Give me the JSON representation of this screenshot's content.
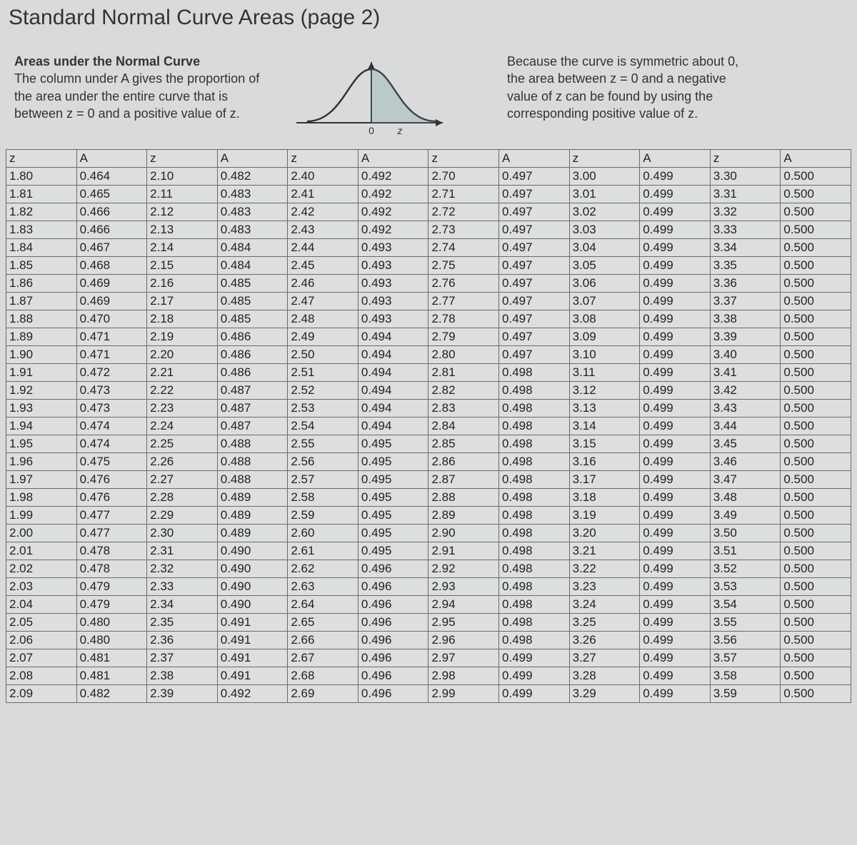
{
  "title": "Standard Normal Curve Areas (page 2)",
  "intro_left_title": "Areas under the Normal Curve",
  "intro_left_body": "The column under A gives the proportion of the area under the entire curve that is between z = 0 and a positive value of z.",
  "intro_right": "Because the curve is symmetric about 0, the area between z = 0 and a negative value of z can be found by using the corresponding positive value of z.",
  "curve_labels": {
    "origin": "0",
    "axis": "z"
  },
  "header": [
    "z",
    "A",
    "z",
    "A",
    "z",
    "A",
    "z",
    "A",
    "z",
    "A",
    "z",
    "A"
  ],
  "rows": [
    [
      "1.80",
      "0.464",
      "2.10",
      "0.482",
      "2.40",
      "0.492",
      "2.70",
      "0.497",
      "3.00",
      "0.499",
      "3.30",
      "0.500"
    ],
    [
      "1.81",
      "0.465",
      "2.11",
      "0.483",
      "2.41",
      "0.492",
      "2.71",
      "0.497",
      "3.01",
      "0.499",
      "3.31",
      "0.500"
    ],
    [
      "1.82",
      "0.466",
      "2.12",
      "0.483",
      "2.42",
      "0.492",
      "2.72",
      "0.497",
      "3.02",
      "0.499",
      "3.32",
      "0.500"
    ],
    [
      "1.83",
      "0.466",
      "2.13",
      "0.483",
      "2.43",
      "0.492",
      "2.73",
      "0.497",
      "3.03",
      "0.499",
      "3.33",
      "0.500"
    ],
    [
      "1.84",
      "0.467",
      "2.14",
      "0.484",
      "2.44",
      "0.493",
      "2.74",
      "0.497",
      "3.04",
      "0.499",
      "3.34",
      "0.500"
    ],
    [
      "1.85",
      "0.468",
      "2.15",
      "0.484",
      "2.45",
      "0.493",
      "2.75",
      "0.497",
      "3.05",
      "0.499",
      "3.35",
      "0.500"
    ],
    [
      "1.86",
      "0.469",
      "2.16",
      "0.485",
      "2.46",
      "0.493",
      "2.76",
      "0.497",
      "3.06",
      "0.499",
      "3.36",
      "0.500"
    ],
    [
      "1.87",
      "0.469",
      "2.17",
      "0.485",
      "2.47",
      "0.493",
      "2.77",
      "0.497",
      "3.07",
      "0.499",
      "3.37",
      "0.500"
    ],
    [
      "1.88",
      "0.470",
      "2.18",
      "0.485",
      "2.48",
      "0.493",
      "2.78",
      "0.497",
      "3.08",
      "0.499",
      "3.38",
      "0.500"
    ],
    [
      "1.89",
      "0.471",
      "2.19",
      "0.486",
      "2.49",
      "0.494",
      "2.79",
      "0.497",
      "3.09",
      "0.499",
      "3.39",
      "0.500"
    ],
    [
      "1.90",
      "0.471",
      "2.20",
      "0.486",
      "2.50",
      "0.494",
      "2.80",
      "0.497",
      "3.10",
      "0.499",
      "3.40",
      "0.500"
    ],
    [
      "1.91",
      "0.472",
      "2.21",
      "0.486",
      "2.51",
      "0.494",
      "2.81",
      "0.498",
      "3.11",
      "0.499",
      "3.41",
      "0.500"
    ],
    [
      "1.92",
      "0.473",
      "2.22",
      "0.487",
      "2.52",
      "0.494",
      "2.82",
      "0.498",
      "3.12",
      "0.499",
      "3.42",
      "0.500"
    ],
    [
      "1.93",
      "0.473",
      "2.23",
      "0.487",
      "2.53",
      "0.494",
      "2.83",
      "0.498",
      "3.13",
      "0.499",
      "3.43",
      "0.500"
    ],
    [
      "1.94",
      "0.474",
      "2.24",
      "0.487",
      "2.54",
      "0.494",
      "2.84",
      "0.498",
      "3.14",
      "0.499",
      "3.44",
      "0.500"
    ],
    [
      "1.95",
      "0.474",
      "2.25",
      "0.488",
      "2.55",
      "0.495",
      "2.85",
      "0.498",
      "3.15",
      "0.499",
      "3.45",
      "0.500"
    ],
    [
      "1.96",
      "0.475",
      "2.26",
      "0.488",
      "2.56",
      "0.495",
      "2.86",
      "0.498",
      "3.16",
      "0.499",
      "3.46",
      "0.500"
    ],
    [
      "1.97",
      "0.476",
      "2.27",
      "0.488",
      "2.57",
      "0.495",
      "2.87",
      "0.498",
      "3.17",
      "0.499",
      "3.47",
      "0.500"
    ],
    [
      "1.98",
      "0.476",
      "2.28",
      "0.489",
      "2.58",
      "0.495",
      "2.88",
      "0.498",
      "3.18",
      "0.499",
      "3.48",
      "0.500"
    ],
    [
      "1.99",
      "0.477",
      "2.29",
      "0.489",
      "2.59",
      "0.495",
      "2.89",
      "0.498",
      "3.19",
      "0.499",
      "3.49",
      "0.500"
    ],
    [
      "2.00",
      "0.477",
      "2.30",
      "0.489",
      "2.60",
      "0.495",
      "2.90",
      "0.498",
      "3.20",
      "0.499",
      "3.50",
      "0.500"
    ],
    [
      "2.01",
      "0.478",
      "2.31",
      "0.490",
      "2.61",
      "0.495",
      "2.91",
      "0.498",
      "3.21",
      "0.499",
      "3.51",
      "0.500"
    ],
    [
      "2.02",
      "0.478",
      "2.32",
      "0.490",
      "2.62",
      "0.496",
      "2.92",
      "0.498",
      "3.22",
      "0.499",
      "3.52",
      "0.500"
    ],
    [
      "2.03",
      "0.479",
      "2.33",
      "0.490",
      "2.63",
      "0.496",
      "2.93",
      "0.498",
      "3.23",
      "0.499",
      "3.53",
      "0.500"
    ],
    [
      "2.04",
      "0.479",
      "2.34",
      "0.490",
      "2.64",
      "0.496",
      "2.94",
      "0.498",
      "3.24",
      "0.499",
      "3.54",
      "0.500"
    ],
    [
      "2.05",
      "0.480",
      "2.35",
      "0.491",
      "2.65",
      "0.496",
      "2.95",
      "0.498",
      "3.25",
      "0.499",
      "3.55",
      "0.500"
    ],
    [
      "2.06",
      "0.480",
      "2.36",
      "0.491",
      "2.66",
      "0.496",
      "2.96",
      "0.498",
      "3.26",
      "0.499",
      "3.56",
      "0.500"
    ],
    [
      "2.07",
      "0.481",
      "2.37",
      "0.491",
      "2.67",
      "0.496",
      "2.97",
      "0.499",
      "3.27",
      "0.499",
      "3.57",
      "0.500"
    ],
    [
      "2.08",
      "0.481",
      "2.38",
      "0.491",
      "2.68",
      "0.496",
      "2.98",
      "0.499",
      "3.28",
      "0.499",
      "3.58",
      "0.500"
    ],
    [
      "2.09",
      "0.482",
      "2.39",
      "0.492",
      "2.69",
      "0.496",
      "2.99",
      "0.499",
      "3.29",
      "0.499",
      "3.59",
      "0.500"
    ]
  ]
}
